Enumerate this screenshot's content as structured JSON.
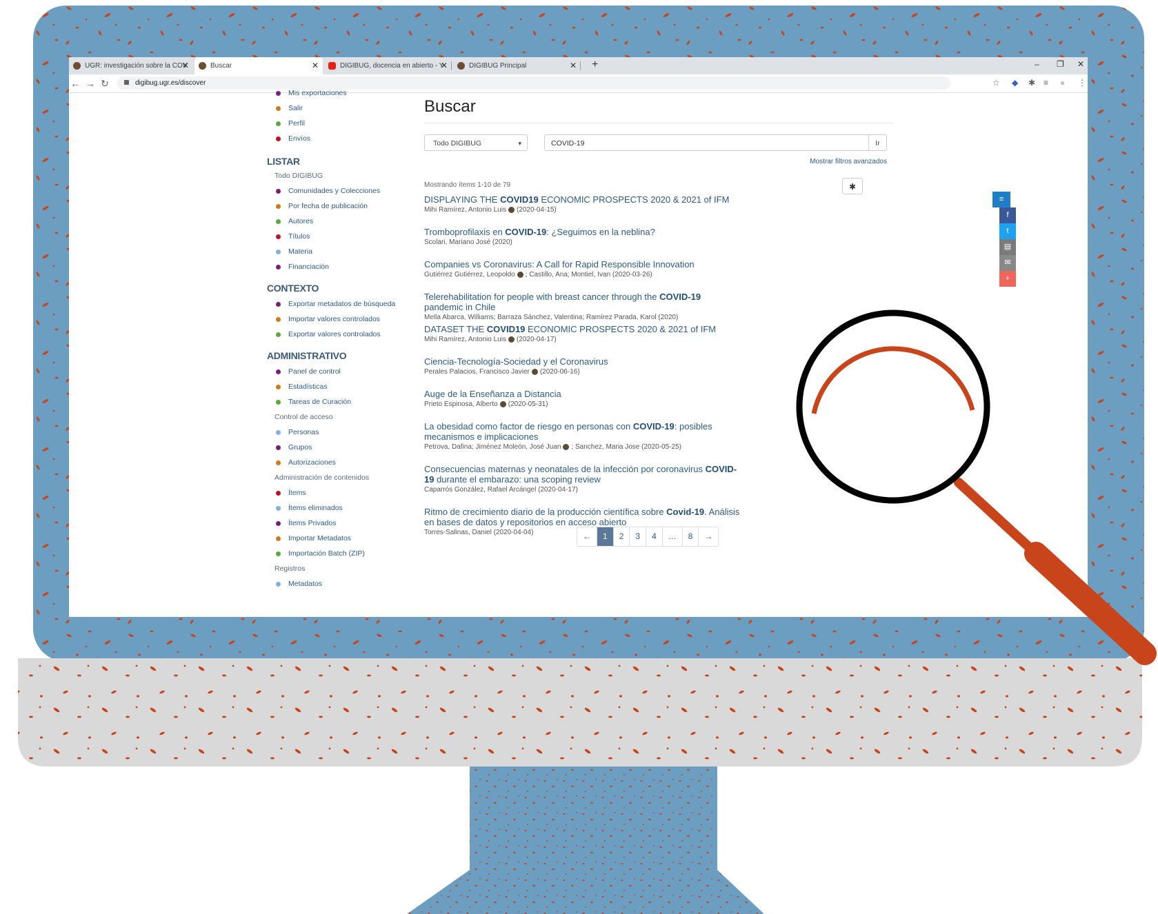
{
  "browser": {
    "tabs": [
      {
        "title": "UGR: investigación sobre la COV",
        "active": false,
        "icon": "ugr-seal-icon"
      },
      {
        "title": "Buscar",
        "active": true,
        "icon": "ugr-seal-icon"
      },
      {
        "title": "DIGIBUG, docencia en abierto - Y",
        "active": false,
        "icon": "youtube-icon"
      },
      {
        "title": "DIGIBUG Principal",
        "active": false,
        "icon": "ugr-seal-icon"
      }
    ],
    "new_tab": "+",
    "url": "digibug.ugr.es/discover"
  },
  "sidebar": {
    "top_items": [
      "Mis exportaciones",
      "Salir",
      "Perfil",
      "Envíos"
    ],
    "listar_heading": "LISTAR",
    "listar_sub": "Todo DIGIBUG",
    "listar_items": [
      "Comunidades y Colecciones",
      "Por fecha de publicación",
      "Autores",
      "Títulos",
      "Materia",
      "Financiación"
    ],
    "contexto_heading": "CONTEXTO",
    "contexto_items": [
      "Exportar metadatos de búsqueda",
      "Importar valores controlados",
      "Exportar valores controlados"
    ],
    "admin_heading": "ADMINISTRATIVO",
    "admin_items": [
      "Panel de control",
      "Estadísticas",
      "Tareas de Curación"
    ],
    "control_acceso_label": "Control de acceso",
    "control_acceso_items": [
      "Personas",
      "Grupos",
      "Autorizaciones"
    ],
    "admin_contenidos_label": "Administración de contenidos",
    "admin_contenidos_items": [
      "Ítems",
      "Ítems eliminados",
      "Ítems Privados",
      "Importar Metadatos",
      "Importación Batch (ZIP)"
    ],
    "registros_label": "Registros",
    "registros_items": [
      "Metadatos"
    ]
  },
  "search": {
    "heading": "Buscar",
    "scope": "Todo DIGIBUG",
    "query": "COVID-19",
    "go_label": "Ir",
    "advanced_link": "Mostrar filtros avanzados",
    "showing": "Mostrando ítems 1-10 de 79"
  },
  "results": [
    {
      "pre": "DISPLAYING THE ",
      "hl": "COVID19",
      "post": " ECONOMIC PROSPECTS 2020 & 2021 of IFM",
      "meta": "Mihi Ramírez, Antonio Luis",
      "seal": true,
      "date": "(2020-04-15)"
    },
    {
      "pre": "Tromboprofilaxis en ",
      "hl": "COVID-19",
      "post": ": ¿Seguimos en la neblina?",
      "meta": "Scolari, Mariano José (2020)",
      "seal": false,
      "date": ""
    },
    {
      "pre": "Companies vs Coronavirus: A Call for Rapid Responsible Innovation",
      "hl": "",
      "post": "",
      "meta": "Gutiérrez Gutiérrez, Leopoldo",
      "seal": true,
      "date": "; Castillo, Ana; Montiel, Ivan (2020-03-26)"
    },
    {
      "pre": "Telerehabilitation for people with breast cancer through the ",
      "hl": "COVID-19",
      "post": " pandemic in Chile",
      "meta": "Mella Abarca, Williams; Barraza Sánchez, Valentina; Ramírez Parada, Karol (2020)",
      "seal": false,
      "date": ""
    },
    {
      "pre": "DATASET THE ",
      "hl": "COVID19",
      "post": " ECONOMIC PROSPECTS 2020 & 2021 of IFM",
      "meta": "Mihi Ramírez, Antonio Luis",
      "seal": true,
      "date": "(2020-04-17)"
    },
    {
      "pre": "Ciencia-Tecnología-Sociedad y el Coronavirus",
      "hl": "",
      "post": "",
      "meta": "Perales Palacios, Francisco Javier",
      "seal": true,
      "date": "(2020-06-16)"
    },
    {
      "pre": "Auge de la Enseñanza a Distancia",
      "hl": "",
      "post": "",
      "meta": "Prieto Espinosa, Alberto",
      "seal": true,
      "date": "(2020-05-31)"
    },
    {
      "pre": "La obesidad como factor de riesgo en personas con ",
      "hl": "COVID-19",
      "post": ": posibles mecanismos e implicaciones",
      "meta": "Petrova, Dafina; Jiménez Moleón, José Juan",
      "seal": true,
      "date": "; Sanchez, Maria Jose (2020-05-25)"
    },
    {
      "pre": "Consecuencias maternas y neonatales de la infección por coronavirus ",
      "hl": "COVID-19",
      "post": " durante el embarazo: una scoping review",
      "meta": "Caparrós González, Rafael Arcángel (2020-04-17)",
      "seal": false,
      "date": ""
    },
    {
      "pre": "Ritmo de crecimiento diario de la producción científica sobre ",
      "hl": "Covid-19",
      "post": ". Análisis en bases de datos y repositorios en acceso abierto",
      "meta": "Torres-Salinas, Daniel (2020-04-04)",
      "seal": false,
      "date": ""
    }
  ],
  "pagination": {
    "prev": "←",
    "pages": [
      "1",
      "2",
      "3",
      "4",
      "…",
      "8"
    ],
    "current": "1",
    "next": "→"
  },
  "share": [
    "facebook-icon",
    "twitter-icon",
    "print-icon",
    "email-icon",
    "plus-icon"
  ],
  "colors": {
    "frame_blue": "#6c9ec1",
    "speckle_orange": "#c8441a",
    "base_gray": "#d9d9d9",
    "link_blue": "#2d5a88",
    "page_active": "#5b7898"
  }
}
